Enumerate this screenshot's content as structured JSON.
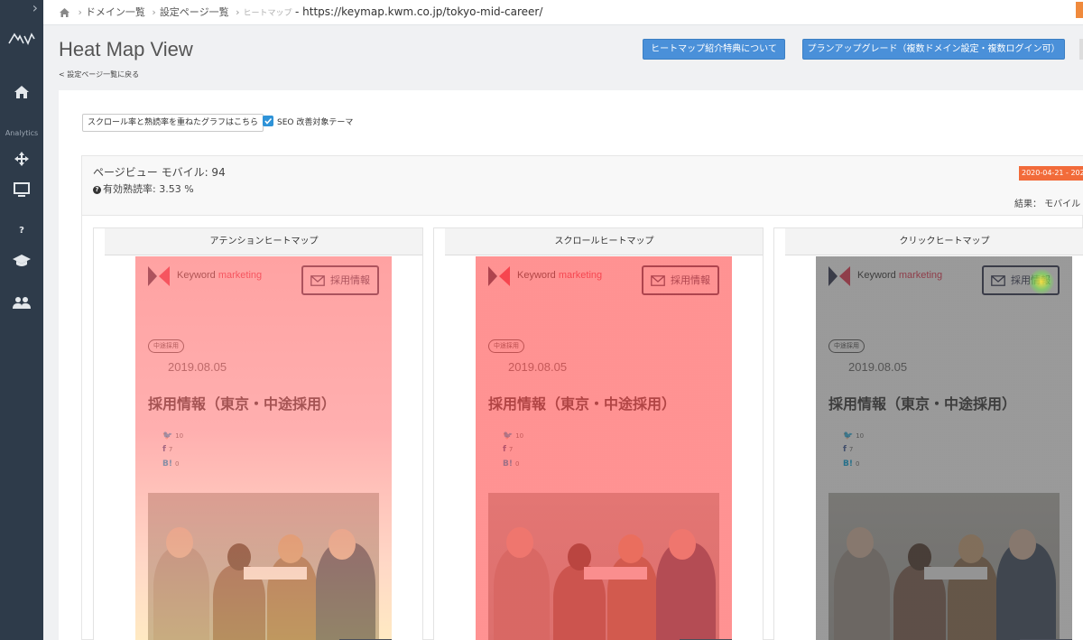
{
  "sidebar": {
    "analytics_label": "Analytics",
    "help_label": "?"
  },
  "breadcrumb": {
    "item1": "ドメイン一覧",
    "item2": "設定ページ一覧",
    "current": "ヒートマップ",
    "url": "- https://keymap.kwm.co.jp/tokyo-mid-career/"
  },
  "header": {
    "title": "Heat Map View",
    "back_link": "< 設定ページ一覧に戻る",
    "button_intro": "ヒートマップ紹介特典について",
    "button_upgrade": "プランアップグレード（複数ドメイン設定・複数ログイン可）"
  },
  "controls": {
    "graph_button": "スクロール率と熟読率を重ねたグラフはこちら",
    "seo_label": "SEO 改善対象テーマ",
    "seo_checked": true
  },
  "stats": {
    "pageview": "ページビュー モバイル: 94",
    "read_rate": "有効熟読率: 3.53 %",
    "date_range": "2020-04-21 - 202",
    "result": "結果： モバイル"
  },
  "heatmaps": [
    {
      "title": "アテンションヒートマップ",
      "overlay_color": "#ff6b6b"
    },
    {
      "title": "スクロールヒートマップ",
      "overlay_color": "#ff5555"
    },
    {
      "title": "クリックヒートマップ",
      "overlay_color": "#5a5a5a"
    }
  ],
  "page_preview": {
    "brand": "Keyword",
    "brand_accent": "marketing",
    "recruit_button": "採用情報",
    "tag": "中途採用",
    "date": "2019.08.05",
    "title": "採用情報（東京・中途採用）",
    "twitter_count": "10",
    "facebook_count": "7",
    "hatena_label": "B!",
    "hatena_count": "0"
  },
  "colors": {
    "sidebar_bg": "#2e3b4a",
    "primary_button": "#4a90d9",
    "date_badge": "#f26b3a",
    "brand_red": "#e8344e"
  }
}
